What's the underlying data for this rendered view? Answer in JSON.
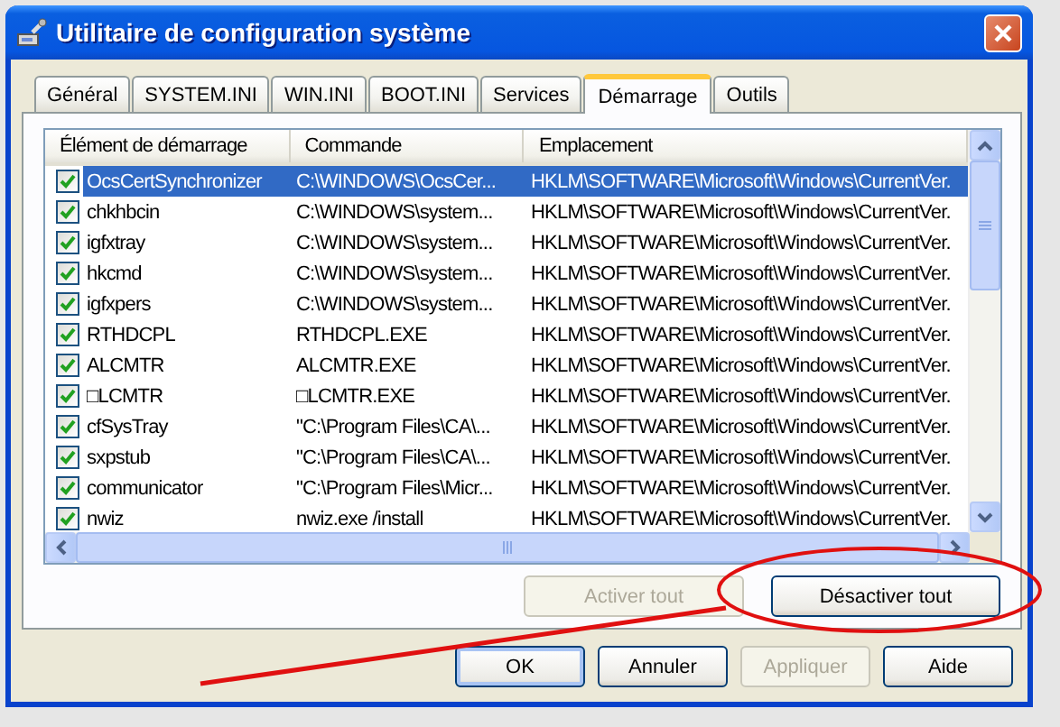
{
  "window": {
    "title": "Utilitaire de configuration système"
  },
  "tabs": [
    {
      "label": "Général",
      "selected": false
    },
    {
      "label": "SYSTEM.INI",
      "selected": false
    },
    {
      "label": "WIN.INI",
      "selected": false
    },
    {
      "label": "BOOT.INI",
      "selected": false
    },
    {
      "label": "Services",
      "selected": false
    },
    {
      "label": "Démarrage",
      "selected": true
    },
    {
      "label": "Outils",
      "selected": false
    }
  ],
  "startup_list": {
    "columns": [
      "Élément de démarrage",
      "Commande",
      "Emplacement"
    ],
    "rows": [
      {
        "item": "OcsCertSynchronizer",
        "command": "C:\\WINDOWS\\OcsCer...",
        "location": "HKLM\\SOFTWARE\\Microsoft\\Windows\\CurrentVer.",
        "checked": true,
        "selected": true
      },
      {
        "item": "chkhbcin",
        "command": "C:\\WINDOWS\\system...",
        "location": "HKLM\\SOFTWARE\\Microsoft\\Windows\\CurrentVer.",
        "checked": true,
        "selected": false
      },
      {
        "item": "igfxtray",
        "command": "C:\\WINDOWS\\system...",
        "location": "HKLM\\SOFTWARE\\Microsoft\\Windows\\CurrentVer.",
        "checked": true,
        "selected": false
      },
      {
        "item": "hkcmd",
        "command": "C:\\WINDOWS\\system...",
        "location": "HKLM\\SOFTWARE\\Microsoft\\Windows\\CurrentVer.",
        "checked": true,
        "selected": false
      },
      {
        "item": "igfxpers",
        "command": "C:\\WINDOWS\\system...",
        "location": "HKLM\\SOFTWARE\\Microsoft\\Windows\\CurrentVer.",
        "checked": true,
        "selected": false
      },
      {
        "item": "RTHDCPL",
        "command": "RTHDCPL.EXE",
        "location": "HKLM\\SOFTWARE\\Microsoft\\Windows\\CurrentVer.",
        "checked": true,
        "selected": false
      },
      {
        "item": "ALCMTR",
        "command": "ALCMTR.EXE",
        "location": "HKLM\\SOFTWARE\\Microsoft\\Windows\\CurrentVer.",
        "checked": true,
        "selected": false
      },
      {
        "item": "□LCMTR",
        "command": "□LCMTR.EXE",
        "location": "HKLM\\SOFTWARE\\Microsoft\\Windows\\CurrentVer.",
        "checked": true,
        "selected": false
      },
      {
        "item": "cfSysTray",
        "command": "\"C:\\Program Files\\CA\\...",
        "location": "HKLM\\SOFTWARE\\Microsoft\\Windows\\CurrentVer.",
        "checked": true,
        "selected": false
      },
      {
        "item": "sxpstub",
        "command": "\"C:\\Program Files\\CA\\...",
        "location": "HKLM\\SOFTWARE\\Microsoft\\Windows\\CurrentVer.",
        "checked": true,
        "selected": false
      },
      {
        "item": "communicator",
        "command": "\"C:\\Program Files\\Micr...",
        "location": "HKLM\\SOFTWARE\\Microsoft\\Windows\\CurrentVer.",
        "checked": true,
        "selected": false
      },
      {
        "item": "nwiz",
        "command": "nwiz.exe /install",
        "location": "HKLM\\SOFTWARE\\Microsoft\\Windows\\CurrentVer.",
        "checked": true,
        "selected": false
      }
    ]
  },
  "panel_buttons": [
    {
      "label": "Activer tout",
      "disabled": true
    },
    {
      "label": "Désactiver tout",
      "disabled": false
    }
  ],
  "dialog_buttons": [
    {
      "label": "OK",
      "disabled": false
    },
    {
      "label": "Annuler",
      "disabled": false
    },
    {
      "label": "Appliquer",
      "disabled": true
    },
    {
      "label": "Aide",
      "disabled": false
    }
  ],
  "annotation": {
    "kind": "ring_and_line"
  }
}
